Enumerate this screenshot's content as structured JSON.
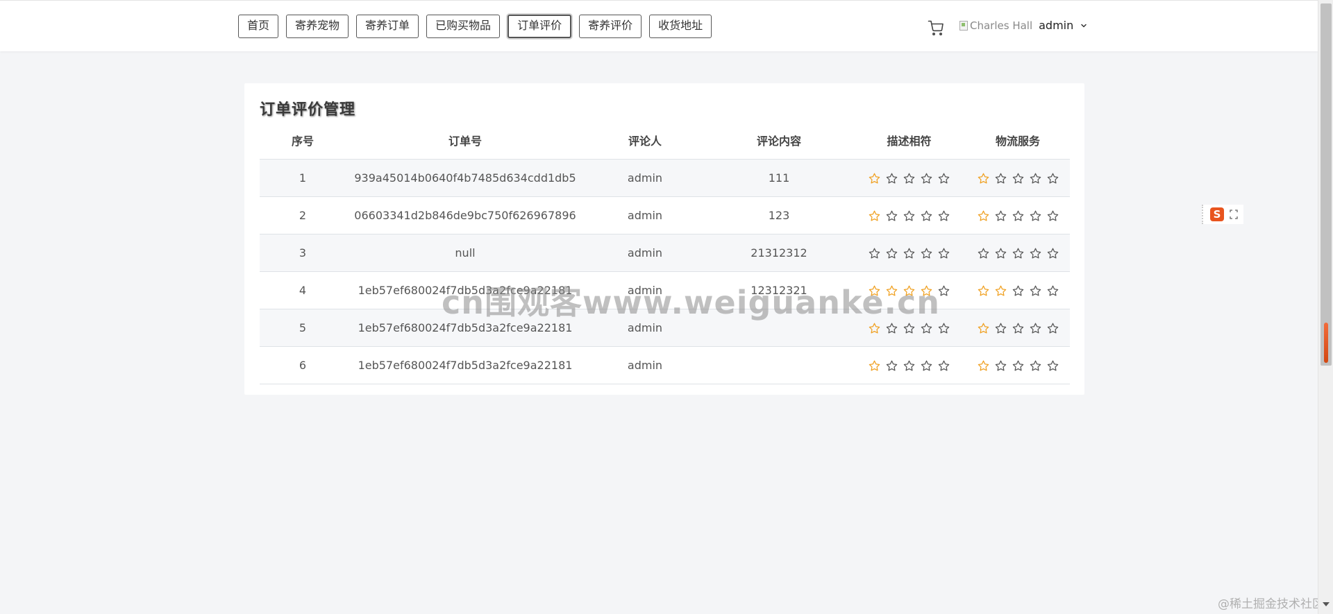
{
  "nav": {
    "buttons": [
      "首页",
      "寄养宠物",
      "寄养订单",
      "已购买物品",
      "订单评价",
      "寄养评价",
      "收货地址"
    ],
    "active_index": 4
  },
  "header": {
    "cart_icon": "cart-icon",
    "avatar_alt": "Charles Hall",
    "user_name": "admin"
  },
  "panel": {
    "title": "订单评价管理",
    "columns": [
      "序号",
      "订单号",
      "评论人",
      "评论内容",
      "描述相符",
      "物流服务"
    ],
    "rows": [
      {
        "index": "1",
        "order_no": "939a45014b0640f4b7485d634cdd1db5",
        "reviewer": "admin",
        "content": "111",
        "desc_rating": 1,
        "logistics_rating": 1
      },
      {
        "index": "2",
        "order_no": "06603341d2b846de9bc750f626967896",
        "reviewer": "admin",
        "content": "123",
        "desc_rating": 1,
        "logistics_rating": 1
      },
      {
        "index": "3",
        "order_no": "null",
        "reviewer": "admin",
        "content": "21312312",
        "desc_rating": 0,
        "logistics_rating": 0
      },
      {
        "index": "4",
        "order_no": "1eb57ef680024f7db5d3a2fce9a22181",
        "reviewer": "admin",
        "content": "12312321",
        "desc_rating": 4,
        "logistics_rating": 2
      },
      {
        "index": "5",
        "order_no": "1eb57ef680024f7db5d3a2fce9a22181",
        "reviewer": "admin",
        "content": "",
        "desc_rating": 1,
        "logistics_rating": 1
      },
      {
        "index": "6",
        "order_no": "1eb57ef680024f7db5d3a2fce9a22181",
        "reviewer": "admin",
        "content": "",
        "desc_rating": 1,
        "logistics_rating": 1
      }
    ],
    "max_stars": 5
  },
  "watermark": "cn围观客www.weiguanke.cn",
  "corner_credit": "@稀土掘金技术社区",
  "widget": {
    "logo_letter": "S"
  },
  "colors": {
    "star_filled": "#f0a020",
    "star_empty": "#555555",
    "accent": "#e8541e"
  }
}
